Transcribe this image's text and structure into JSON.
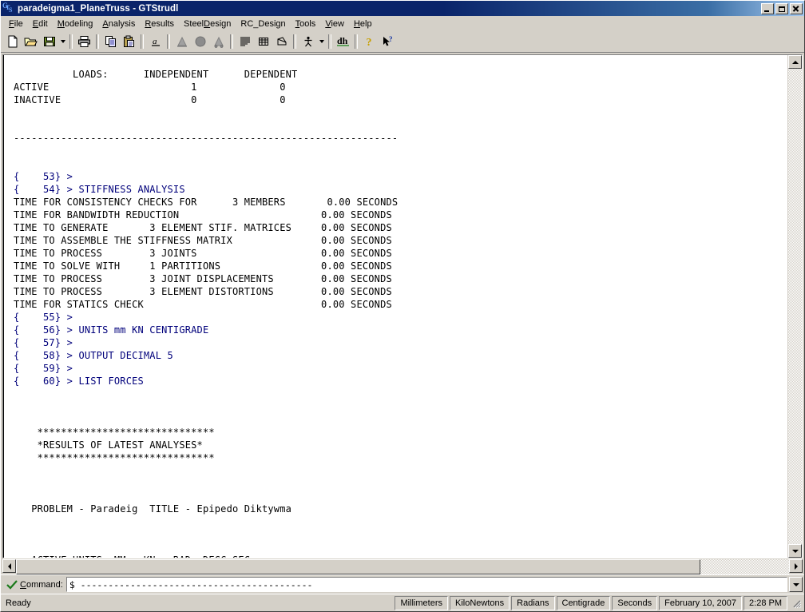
{
  "window": {
    "title": "paradeigma1_PlaneTruss - GTStrudl",
    "icon": "gts-logo-icon",
    "minimize_label": "Minimize",
    "maximize_label": "Maximize",
    "close_label": "Close"
  },
  "menu": {
    "items": [
      {
        "label": "File",
        "mnemonic": "F"
      },
      {
        "label": "Edit",
        "mnemonic": "E"
      },
      {
        "label": "Modeling",
        "mnemonic": "M"
      },
      {
        "label": "Analysis",
        "mnemonic": "A"
      },
      {
        "label": "Results",
        "mnemonic": "R"
      },
      {
        "label": "SteelDesign",
        "mnemonic": "D"
      },
      {
        "label": "RC_Design",
        "mnemonic": "R"
      },
      {
        "label": "Tools",
        "mnemonic": "T"
      },
      {
        "label": "View",
        "mnemonic": "V"
      },
      {
        "label": "Help",
        "mnemonic": "H"
      }
    ]
  },
  "toolbar": {
    "buttons": [
      {
        "name": "new-icon",
        "tooltip": "New"
      },
      {
        "name": "open-folder-icon",
        "tooltip": "Open"
      },
      {
        "name": "save-disk-icon",
        "tooltip": "Save"
      },
      {
        "name": "save-dropdown-arrow-icon",
        "tooltip": "Save options"
      },
      {
        "name": "print-icon",
        "tooltip": "Print"
      },
      {
        "name": "copy-icon",
        "tooltip": "Copy"
      },
      {
        "name": "paste-icon",
        "tooltip": "Paste"
      },
      {
        "name": "font-icon",
        "tooltip": "Font"
      },
      {
        "name": "support-left-icon",
        "tooltip": "Support"
      },
      {
        "name": "circle-icon",
        "tooltip": "Node"
      },
      {
        "name": "support-right-icon",
        "tooltip": "Support"
      },
      {
        "name": "list-lines-icon",
        "tooltip": "List"
      },
      {
        "name": "table-grid-icon",
        "tooltip": "Table"
      },
      {
        "name": "diagram-icon",
        "tooltip": "Diagram"
      },
      {
        "name": "person-icon",
        "tooltip": "Model"
      },
      {
        "name": "person-dropdown-arrow-icon",
        "tooltip": "Model options"
      },
      {
        "name": "dh-icon",
        "tooltip": "dh"
      },
      {
        "name": "help-question-icon",
        "tooltip": "Help"
      },
      {
        "name": "help-pointer-icon",
        "tooltip": "Context help"
      }
    ]
  },
  "console": {
    "lines": [
      {
        "text": "          LOADS:      INDEPENDENT      DEPENDENT",
        "style": "output"
      },
      {
        "text": "ACTIVE                        1              0",
        "style": "output"
      },
      {
        "text": "INACTIVE                      0              0",
        "style": "output"
      },
      {
        "text": "",
        "style": "output"
      },
      {
        "text": "",
        "style": "output"
      },
      {
        "text": "-----------------------------------------------------------------",
        "style": "output"
      },
      {
        "text": "",
        "style": "output"
      },
      {
        "text": "",
        "style": "output"
      },
      {
        "text": "{    53} > ",
        "style": "output"
      },
      {
        "text": "{    54} > ",
        "cmd": "STIFFNESS ANALYSIS",
        "style": "command"
      },
      {
        "text": "TIME FOR CONSISTENCY CHECKS FOR      3 MEMBERS       0.00 SECONDS",
        "style": "output"
      },
      {
        "text": "TIME FOR BANDWIDTH REDUCTION                        0.00 SECONDS",
        "style": "output"
      },
      {
        "text": "TIME TO GENERATE       3 ELEMENT STIF. MATRICES     0.00 SECONDS",
        "style": "output"
      },
      {
        "text": "TIME TO ASSEMBLE THE STIFFNESS MATRIX               0.00 SECONDS",
        "style": "output"
      },
      {
        "text": "TIME TO PROCESS        3 JOINTS                     0.00 SECONDS",
        "style": "output"
      },
      {
        "text": "TIME TO SOLVE WITH     1 PARTITIONS                 0.00 SECONDS",
        "style": "output"
      },
      {
        "text": "TIME TO PROCESS        3 JOINT DISPLACEMENTS        0.00 SECONDS",
        "style": "output"
      },
      {
        "text": "TIME TO PROCESS        3 ELEMENT DISTORTIONS        0.00 SECONDS",
        "style": "output"
      },
      {
        "text": "TIME FOR STATICS CHECK                              0.00 SECONDS",
        "style": "output"
      },
      {
        "text": "{    55} > ",
        "style": "output"
      },
      {
        "text": "{    56} > ",
        "cmd": "UNITS mm KN CENTIGRADE",
        "style": "command"
      },
      {
        "text": "{    57} > ",
        "style": "output"
      },
      {
        "text": "{    58} > ",
        "cmd": "OUTPUT DECIMAL 5",
        "style": "command"
      },
      {
        "text": "{    59} > ",
        "style": "output"
      },
      {
        "text": "{    60} > ",
        "cmd": "LIST FORCES",
        "style": "command"
      },
      {
        "text": "",
        "style": "output"
      },
      {
        "text": "",
        "style": "output"
      },
      {
        "text": "",
        "style": "output"
      },
      {
        "text": "    ******************************",
        "style": "output"
      },
      {
        "text": "    *RESULTS OF LATEST ANALYSES*",
        "style": "output"
      },
      {
        "text": "    ******************************",
        "style": "output"
      },
      {
        "text": "",
        "style": "output"
      },
      {
        "text": "",
        "style": "output"
      },
      {
        "text": "",
        "style": "output"
      },
      {
        "text": "   PROBLEM - Paradeig  TITLE - Epipedo Diktywma",
        "style": "output"
      },
      {
        "text": "",
        "style": "output"
      },
      {
        "text": "",
        "style": "output"
      },
      {
        "text": "",
        "style": "output"
      },
      {
        "text": "   ACTIVE UNITS  MM   KN   RAD  DEGC SEC",
        "style": "output"
      }
    ]
  },
  "command_bar": {
    "check_icon": "green-check-icon",
    "label": "Command:",
    "label_mnemonic": "C",
    "value": "$ ------------------------------------------",
    "placeholder": "",
    "dropdown_icon": "chevron-down-icon"
  },
  "status_bar": {
    "ready_text": "Ready",
    "panels": [
      "Millimeters",
      "KiloNewtons",
      "Radians",
      "Centigrade",
      "Seconds",
      "February 10, 2007",
      "2:28 PM"
    ],
    "grip": "resize-grip-icon"
  },
  "colors": {
    "title_bar_start": "#0a246a",
    "title_bar_end": "#a6caf0",
    "face": "#d4d0c8",
    "command_text": "#00007b",
    "console_bg": "#ffffff"
  }
}
